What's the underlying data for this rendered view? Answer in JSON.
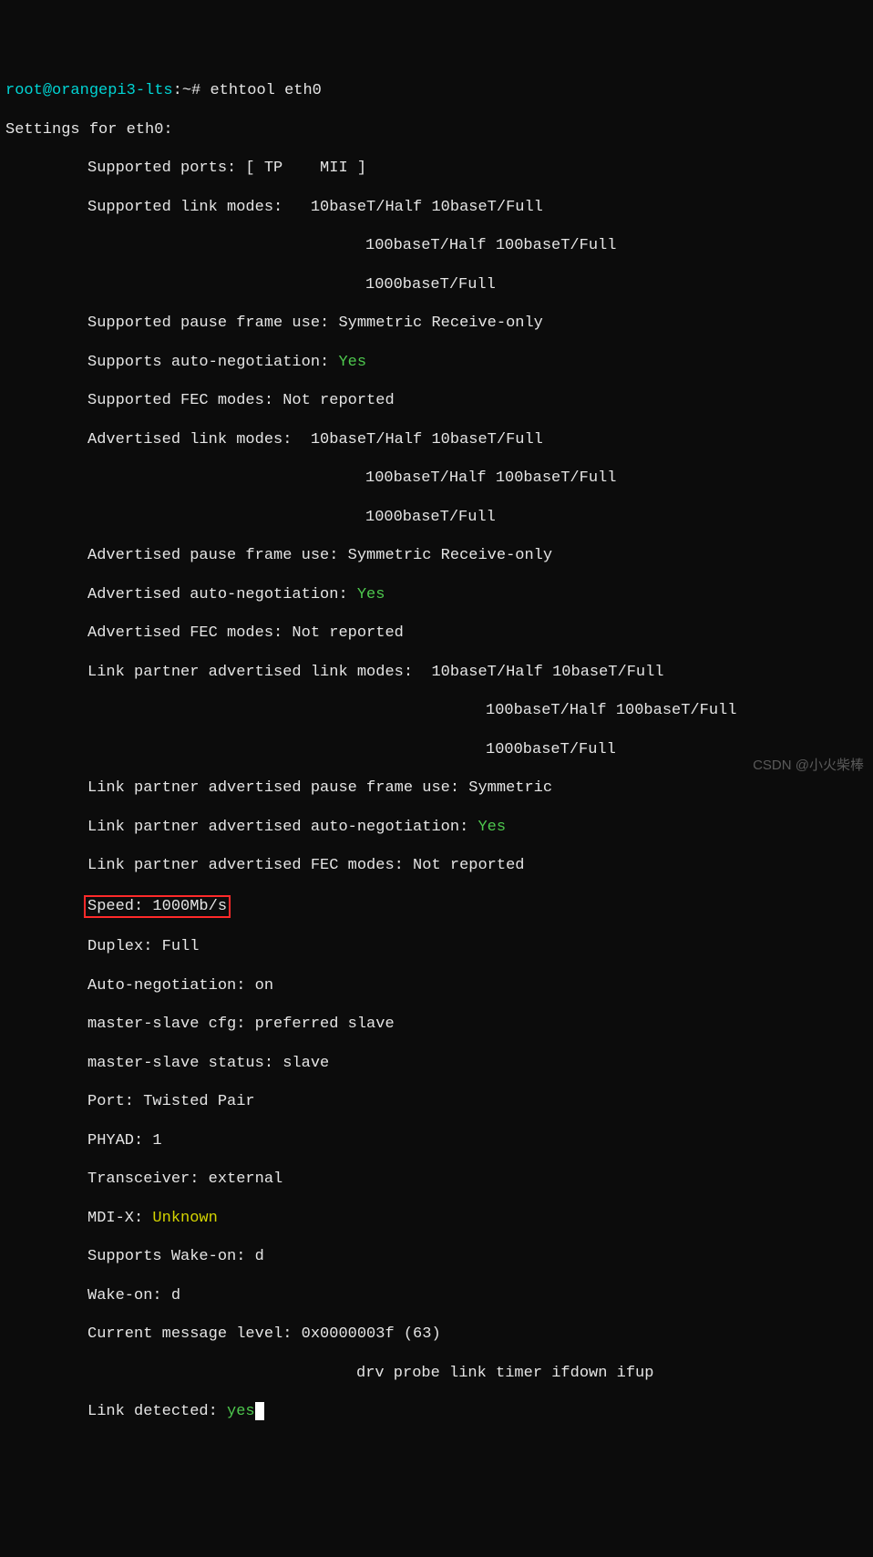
{
  "prompt": {
    "user": "root",
    "host": "orangepi3-lts",
    "path": "~",
    "symbol": "#",
    "command": "ethtool eth0"
  },
  "header": "Settings for eth0:",
  "fields": {
    "supported_ports": "Supported ports: [ TP\t MII ]",
    "supported_link_modes": "Supported link modes:   10baseT/Half 10baseT/Full",
    "supported_link_modes_2": "100baseT/Half 100baseT/Full",
    "supported_link_modes_3": "1000baseT/Full",
    "supported_pause": "Supported pause frame use: Symmetric Receive-only",
    "supports_auto_neg_label": "Supports auto-negotiation: ",
    "supports_auto_neg_val": "Yes",
    "supported_fec": "Supported FEC modes: Not reported",
    "adv_link_modes": "Advertised link modes:  10baseT/Half 10baseT/Full",
    "adv_link_modes_2": "100baseT/Half 100baseT/Full",
    "adv_link_modes_3": "1000baseT/Full",
    "adv_pause": "Advertised pause frame use: Symmetric Receive-only",
    "adv_auto_neg_label": "Advertised auto-negotiation: ",
    "adv_auto_neg_val": "Yes",
    "adv_fec": "Advertised FEC modes: Not reported",
    "lp_link_modes": "Link partner advertised link modes:  10baseT/Half 10baseT/Full",
    "lp_link_modes_2": "100baseT/Half 100baseT/Full",
    "lp_link_modes_3": "1000baseT/Full",
    "lp_pause": "Link partner advertised pause frame use: Symmetric",
    "lp_auto_neg_label": "Link partner advertised auto-negotiation: ",
    "lp_auto_neg_val": "Yes",
    "lp_fec": "Link partner advertised FEC modes: Not reported",
    "speed": "Speed: 1000Mb/s",
    "duplex": "Duplex: Full",
    "auto_neg": "Auto-negotiation: on",
    "ms_cfg": "master-slave cfg: preferred slave",
    "ms_status": "master-slave status: slave",
    "port": "Port: Twisted Pair",
    "phyad": "PHYAD: 1",
    "transceiver": "Transceiver: external",
    "mdix_label": "MDI-X: ",
    "mdix_val": "Unknown",
    "wol_supports": "Supports Wake-on: d",
    "wol": "Wake-on: d",
    "msg_level": "Current message level: 0x0000003f (63)",
    "msg_level_2": "drv probe link timer ifdown ifup",
    "link_detected_label": "Link detected: ",
    "link_detected_val": "yes"
  },
  "watermark": "CSDN @小火柴棒"
}
